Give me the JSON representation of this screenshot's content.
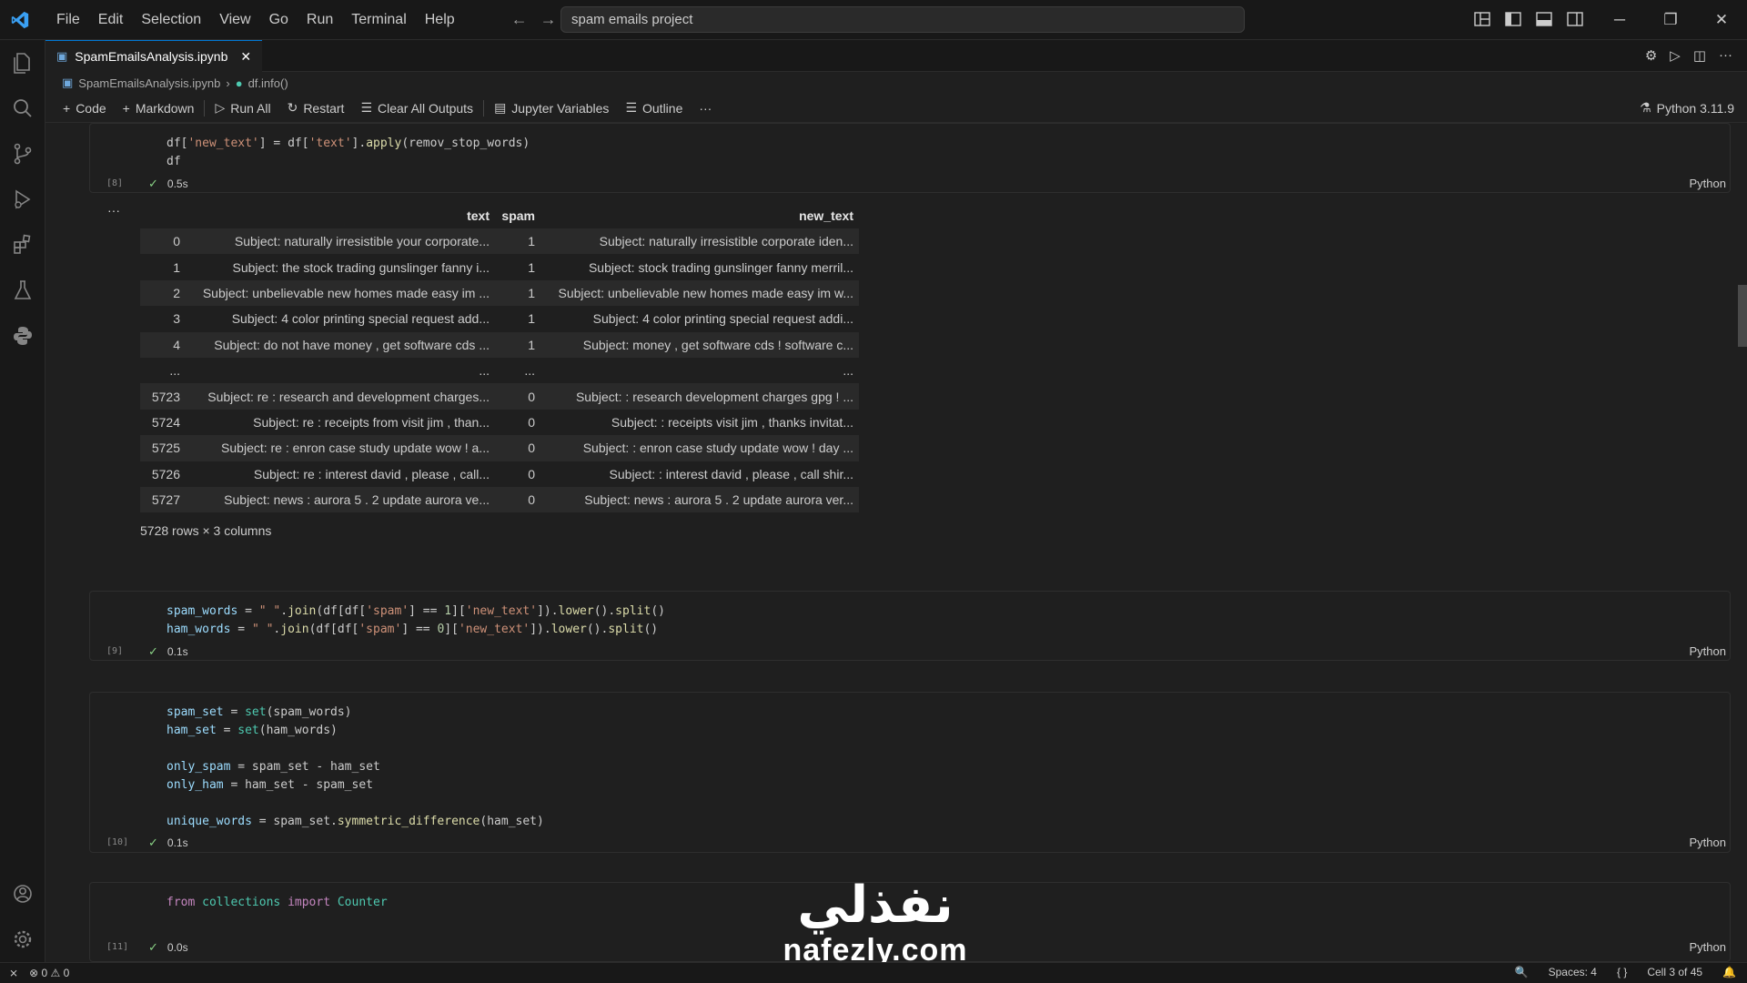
{
  "titlebar": {
    "menu": [
      "File",
      "Edit",
      "Selection",
      "View",
      "Go",
      "Run",
      "Terminal",
      "Help"
    ],
    "search_text": "spam emails project"
  },
  "tab": {
    "name": "SpamEmailsAnalysis.ipynb"
  },
  "breadcrumb": {
    "file": "SpamEmailsAnalysis.ipynb",
    "symbol": "df.info()"
  },
  "toolbar": {
    "code": "Code",
    "markdown": "Markdown",
    "run_all": "Run All",
    "restart": "Restart",
    "clear_outputs": "Clear All Outputs",
    "variables": "Jupyter Variables",
    "outline": "Outline",
    "more": "···",
    "kernel": "Python 3.11.9"
  },
  "cells": [
    {
      "exec": "[8]",
      "time": "0.5s",
      "lang": "Python"
    },
    {
      "exec": "[9]",
      "time": "0.1s",
      "lang": "Python"
    },
    {
      "exec": "[10]",
      "time": "0.1s",
      "lang": "Python"
    },
    {
      "exec": "[11]",
      "time": "0.0s",
      "lang": "Python"
    }
  ],
  "output": {
    "more": "···",
    "columns": [
      "",
      "text",
      "spam",
      "new_text"
    ],
    "rows": [
      [
        "0",
        "Subject: naturally irresistible your corporate...",
        "1",
        "Subject: naturally irresistible corporate iden..."
      ],
      [
        "1",
        "Subject: the stock trading gunslinger  fanny i...",
        "1",
        "Subject: stock trading gunslinger fanny merril..."
      ],
      [
        "2",
        "Subject: unbelievable new homes made easy  im ...",
        "1",
        "Subject: unbelievable new homes made easy im w..."
      ],
      [
        "3",
        "Subject: 4 color printing special  request add...",
        "1",
        "Subject: 4 color printing special request addi..."
      ],
      [
        "4",
        "Subject: do not have money , get software cds ...",
        "1",
        "Subject: money , get software cds ! software c..."
      ],
      [
        "...",
        "...",
        "...",
        "..."
      ],
      [
        "5723",
        "Subject: re : research and development charges...",
        "0",
        "Subject: : research development charges gpg ! ..."
      ],
      [
        "5724",
        "Subject: re : receipts from visit  jim ,  than...",
        "0",
        "Subject: : receipts visit jim , thanks invitat..."
      ],
      [
        "5725",
        "Subject: re : enron case study update  wow ! a...",
        "0",
        "Subject: : enron case study update wow ! day ..."
      ],
      [
        "5726",
        "Subject: re : interest  david ,  please , call...",
        "0",
        "Subject: : interest david , please , call shir..."
      ],
      [
        "5727",
        "Subject: news : aurora 5 . 2 update  aurora ve...",
        "0",
        "Subject: news : aurora 5 . 2 update aurora ver..."
      ]
    ],
    "rowcount": "5728 rows × 3 columns"
  },
  "statusbar": {
    "errors": "0",
    "warnings": "0",
    "spaces": "Spaces: 4",
    "braces": "{ }",
    "cell": "Cell 3 of 45"
  },
  "watermark": {
    "arabic": "نفذلي",
    "latin": "nafezly.com"
  }
}
